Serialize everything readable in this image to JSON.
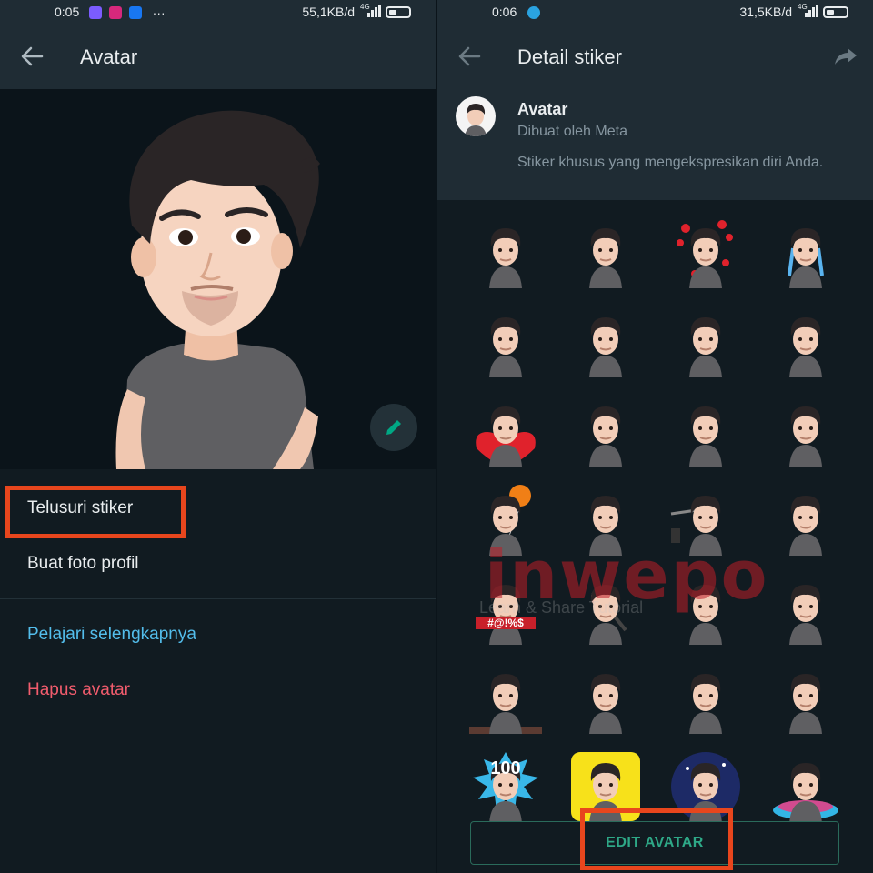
{
  "left": {
    "status": {
      "time": "0:05",
      "net": "55,1KB/d",
      "net_type": "4G"
    },
    "appbar": {
      "title": "Avatar"
    },
    "menu": {
      "browse": "Telusuri stiker",
      "profile_photo": "Buat foto profil",
      "learn_more": "Pelajari selengkapnya",
      "delete": "Hapus avatar"
    }
  },
  "right": {
    "status": {
      "time": "0:06",
      "net": "31,5KB/d",
      "net_type": "4G"
    },
    "appbar": {
      "title": "Detail stiker"
    },
    "pack": {
      "name": "Avatar",
      "author": "Dibuat oleh Meta",
      "description": "Stiker khusus yang mengekspresikan diri Anda."
    },
    "sticker_text": {
      "hundred": "100",
      "censored": "#@!%$"
    },
    "edit_button": "EDIT AVATAR"
  },
  "watermark": {
    "brand": "inwepo",
    "tagline": "Learn & Share Tutorial"
  },
  "colors": {
    "bar": "#1f2c34",
    "background": "#111b21",
    "accent": "#00a884",
    "link": "#53bdeb",
    "danger": "#f15c6d",
    "highlight": "#e8461d"
  }
}
